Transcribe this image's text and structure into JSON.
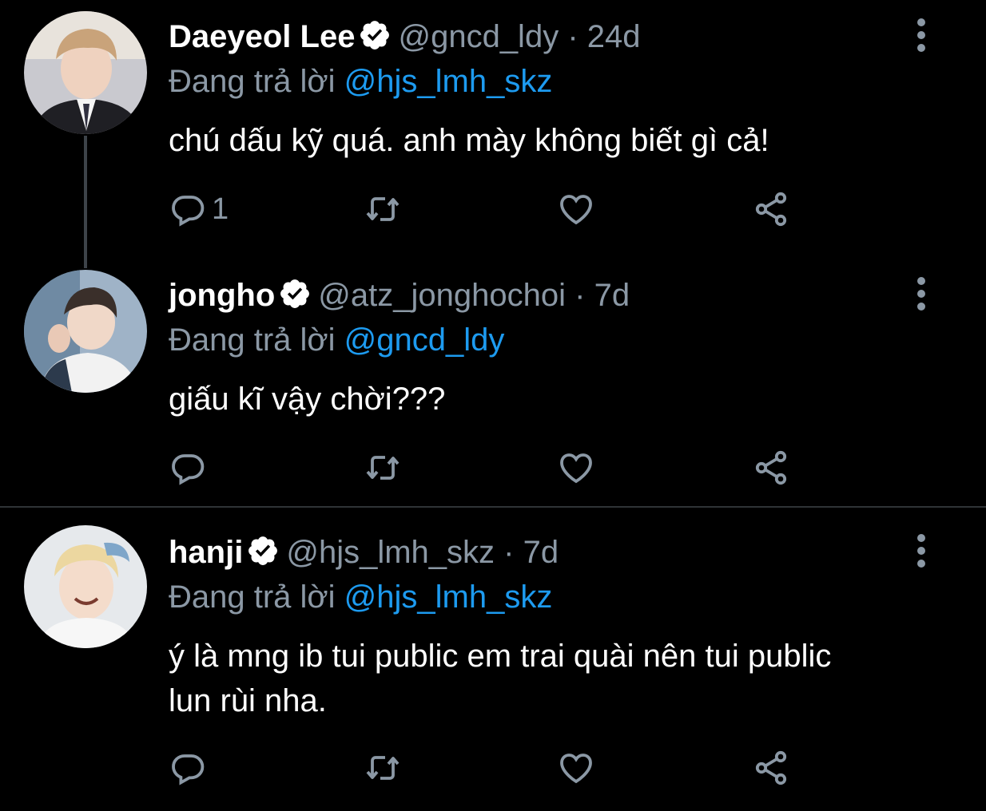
{
  "colors": {
    "background": "#000000",
    "text": "#ffffff",
    "muted": "#8b98a5",
    "link": "#1d9bf0"
  },
  "tweets": [
    {
      "name": "Daeyeol Lee",
      "handle": "@gncd_ldy",
      "separator": "·",
      "time": "24d",
      "reply_prefix": "Đang trả lời",
      "reply_to": "@hjs_lmh_skz",
      "text": "chú dấu kỹ quá. anh mày không biết gì cả!",
      "reply_count": "1"
    },
    {
      "name": "jongho",
      "handle": "@atz_jonghochoi",
      "separator": "·",
      "time": "7d",
      "reply_prefix": "Đang trả lời",
      "reply_to": "@gncd_ldy",
      "text": "giấu kĩ vậy chời???",
      "reply_count": ""
    },
    {
      "name": "hanji",
      "handle": "@hjs_lmh_skz",
      "separator": "·",
      "time": "7d",
      "reply_prefix": "Đang trả lời",
      "reply_to": "@hjs_lmh_skz",
      "text": "ý là mng ib tui public em trai quài nên tui public lun rùi nha.",
      "reply_count": ""
    }
  ]
}
